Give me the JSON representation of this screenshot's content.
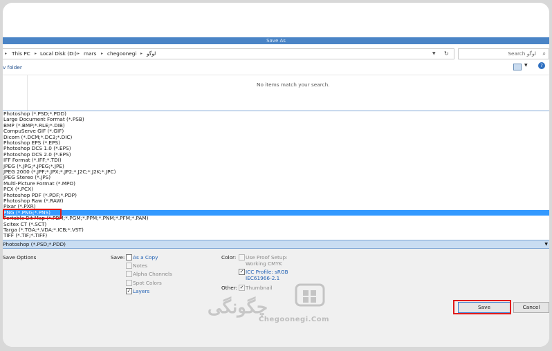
{
  "window": {
    "title": "Save As"
  },
  "address": {
    "crumbs": [
      "This PC",
      "Local Disk (D:)",
      "mars",
      "chegoonegi",
      "لوگو"
    ],
    "search_placeholder": "Search لوگو"
  },
  "toolbar": {
    "new_folder": "v folder"
  },
  "file_area": {
    "empty_message": "No items match your search."
  },
  "formats": {
    "items": [
      "Photoshop (*.PSD;*.PDD)",
      "Large Document Format (*.PSB)",
      "BMP (*.BMP;*.RLE;*.DIB)",
      "CompuServe GIF (*.GIF)",
      "Dicom (*.DCM;*.DC3;*.DIC)",
      "Photoshop EPS (*.EPS)",
      "Photoshop DCS 1.0 (*.EPS)",
      "Photoshop DCS 2.0 (*.EPS)",
      "IFF Format (*.IFF;*.TDI)",
      "JPEG (*.JPG;*.JPEG;*.JPE)",
      "JPEG 2000 (*.JPF;*.JPX;*.JP2;*.J2C;*.J2K;*.JPC)",
      "JPEG Stereo (*.JPS)",
      "Multi-Picture Format (*.MPO)",
      "PCX (*.PCX)",
      "Photoshop PDF (*.PDF;*.PDP)",
      "Photoshop Raw (*.RAW)",
      "Pixar (*.PXR)",
      "PNG (*.PNG;*.PNS)",
      "Portable Bit Map (*.PBM;*.PGM;*.PPM;*.PNM;*.PFM;*.PAM)",
      "Scitex CT (*.SCT)",
      "Targa (*.TGA;*.VDA;*.ICB;*.VST)",
      "TIFF (*.TIF;*.TIFF)"
    ],
    "selected_index": 17,
    "current_value": "Photoshop (*.PSD;*.PDD)"
  },
  "options": {
    "section_label": "Save Options",
    "save_label": "Save:",
    "as_copy": "As a Copy",
    "notes": "Notes",
    "alpha_channels": "Alpha Channels",
    "spot_colors": "Spot Colors",
    "layers": "Layers",
    "color_label": "Color:",
    "use_proof": "Use Proof Setup:",
    "working_cmyk": "Working CMYK",
    "icc_profile": "ICC Profile:  sRGB",
    "icc_profile_2": "IEC61966-2.1",
    "other_label": "Other:",
    "thumbnail": "Thumbnail"
  },
  "buttons": {
    "save": "Save",
    "cancel": "Cancel"
  },
  "watermark": {
    "site": "Chegoonegi.Com",
    "logo_text": "چگونگی"
  },
  "colors": {
    "selection": "#3399ff",
    "titlebar": "#4a84c6",
    "highlight_box": "#e01a1a"
  }
}
